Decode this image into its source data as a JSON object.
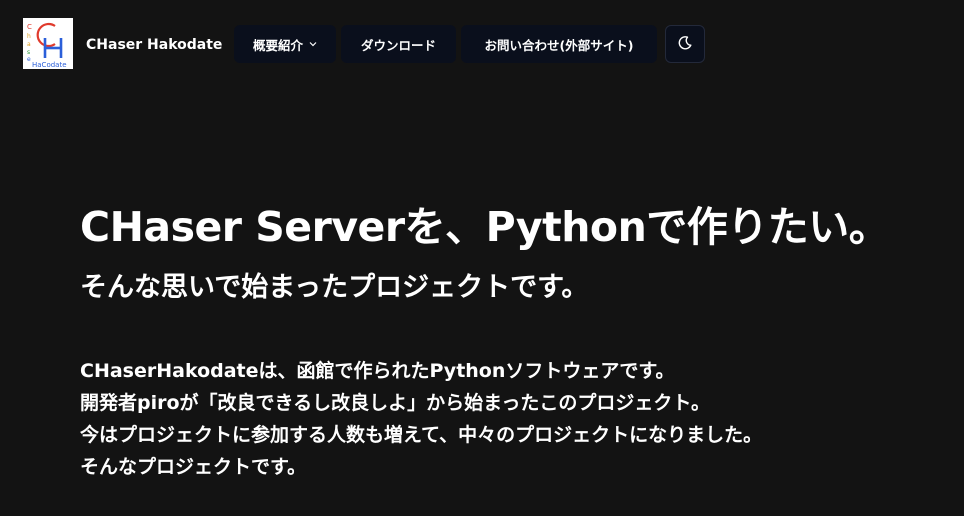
{
  "header": {
    "logo_letters": {
      "c": "C",
      "h": "H",
      "small_vertical": "Chaser",
      "bottom": "HaCodate"
    },
    "brand": "CHaser Hakodate",
    "nav": {
      "about": "概要紹介",
      "download": "ダウンロード",
      "contact": "お問い合わせ(外部サイト)",
      "theme_icon": "moon-icon"
    }
  },
  "hero": {
    "title": "CHaser Serverを、Pythonで作りたい。",
    "subtitle": "そんな思いで始まったプロジェクトです。",
    "lines": [
      "CHaserHakodateは、函館で作られたPythonソフトウェアです。",
      "開発者piroが「改良できるし改良しよ」から始まったこのプロジェクト。",
      "今はプロジェクトに参加する人数も増えて、中々のプロジェクトになりました。",
      "そんなプロジェクトです。"
    ]
  },
  "colors": {
    "background": "#131313",
    "nav_button": "#0a0f1c",
    "logo_c": "#e03a2c",
    "logo_h": "#2b5fd9"
  }
}
